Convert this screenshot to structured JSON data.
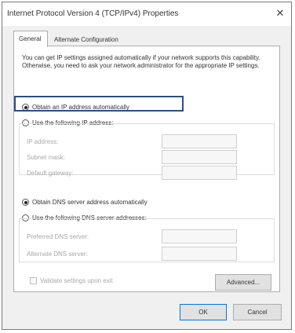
{
  "window": {
    "title": "Internet Protocol Version 4 (TCP/IPv4) Properties",
    "close_glyph": "✕"
  },
  "tabs": [
    {
      "label": "General"
    },
    {
      "label": "Alternate Configuration"
    }
  ],
  "intro_text": "You can get IP settings assigned automatically if your network supports this capability. Otherwise, you need to ask your network administrator for the appropriate IP settings.",
  "ip_mode": {
    "auto_label": "Obtain an IP address automatically",
    "manual_label": "Use the following IP address:",
    "selected": "auto"
  },
  "ip_fields": [
    {
      "label": "IP address:",
      "value": ""
    },
    {
      "label": "Subnet mask:",
      "value": ""
    },
    {
      "label": "Default gateway:",
      "value": ""
    }
  ],
  "dns_mode": {
    "auto_label": "Obtain DNS server address automatically",
    "manual_label": "Use the following DNS server addresses:",
    "selected": "auto"
  },
  "dns_fields": [
    {
      "label": "Preferred DNS server:",
      "value": ""
    },
    {
      "label": "Alternate DNS server:",
      "value": ""
    }
  ],
  "validate_label": "Validate settings upon exit",
  "buttons": {
    "advanced": "Advanced...",
    "ok": "OK",
    "cancel": "Cancel"
  }
}
